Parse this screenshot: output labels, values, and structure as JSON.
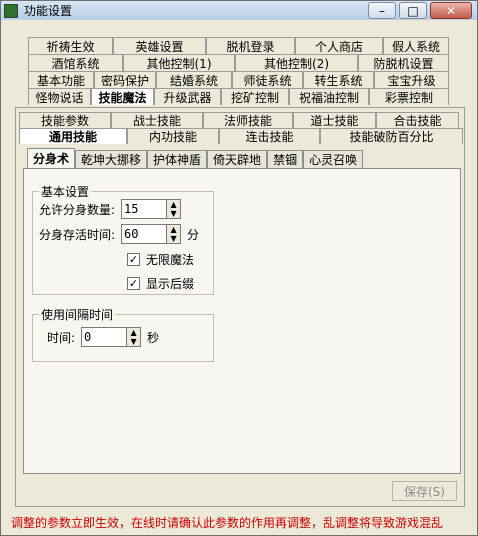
{
  "window": {
    "title": "功能设置",
    "buttons": {
      "minimize": "–",
      "maximize": "□",
      "close": "✕"
    }
  },
  "tabs": {
    "rows": [
      [
        "祈祷生效",
        "英雄设置",
        "脱机登录",
        "个人商店",
        "假人系统"
      ],
      [
        "酒馆系统",
        "其他控制(1)",
        "其他控制(2)",
        "防脱机设置"
      ],
      [
        "基本功能",
        "密码保护",
        "结婚系统",
        "师徒系统",
        "转生系统",
        "宝宝升级"
      ],
      [
        "怪物说话",
        "技能魔法",
        "升级武器",
        "挖矿控制",
        "祝福油控制",
        "彩票控制"
      ]
    ],
    "active": "技能魔法"
  },
  "inner_tabs": {
    "rows": [
      [
        "技能参数",
        "战士技能",
        "法师技能",
        "道士技能",
        "合击技能"
      ],
      [
        "通用技能",
        "内功技能",
        "连击技能",
        "技能破防百分比"
      ]
    ],
    "active": "通用技能"
  },
  "subtabs": {
    "items": [
      "分身术",
      "乾坤大挪移",
      "护体神盾",
      "倚天辟地",
      "禁锢",
      "心灵召唤"
    ],
    "active": "分身术"
  },
  "basic_settings": {
    "legend": "基本设置",
    "clone_count_label": "允许分身数量:",
    "clone_count_value": "15",
    "survival_time_label": "分身存活时间:",
    "survival_time_value": "60",
    "survival_time_unit": "分",
    "infinite_magic_label": "无限魔法",
    "show_suffix_label": "显示后缀",
    "checkbox_mark": "✓"
  },
  "interval_settings": {
    "legend": "使用间隔时间",
    "time_label": "时间:",
    "time_value": "0",
    "time_unit": "秒"
  },
  "save_button_label": "保存(S)",
  "footer_note": "调整的参数立即生效，在线时请确认此参数的作用再调整，乱调整将导致游戏混乱"
}
